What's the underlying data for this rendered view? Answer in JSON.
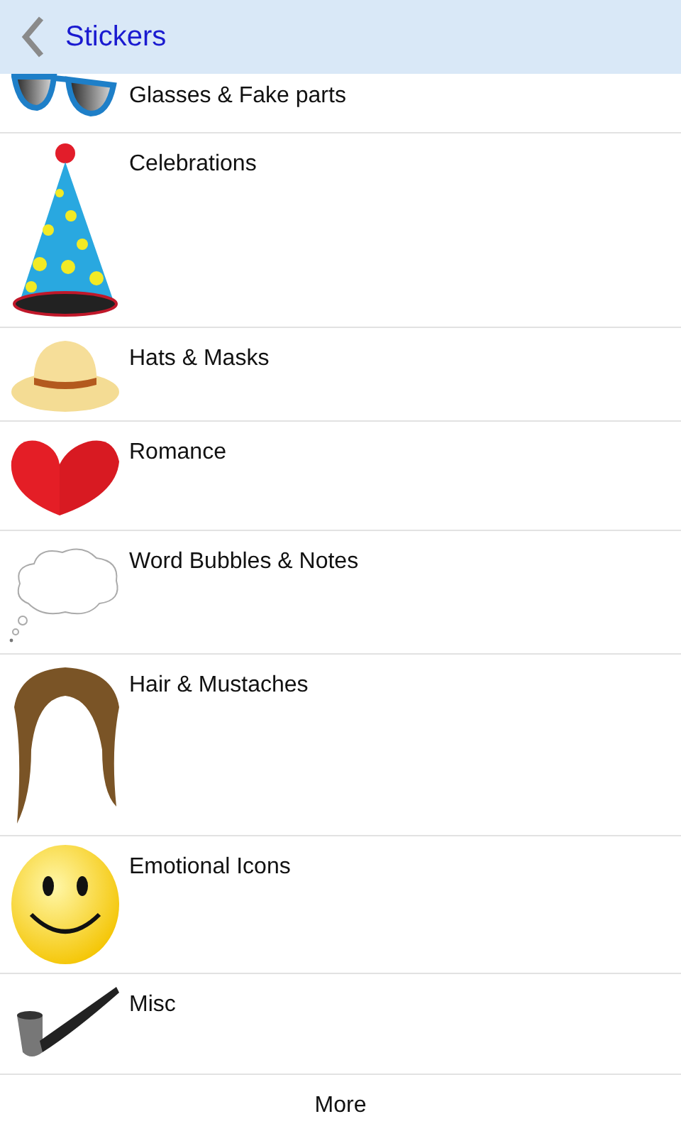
{
  "header": {
    "title": "Stickers"
  },
  "categories": [
    {
      "label": "Glasses & Fake parts",
      "kind": "glasses"
    },
    {
      "label": "Celebrations",
      "kind": "party-hat"
    },
    {
      "label": "Hats & Masks",
      "kind": "hat"
    },
    {
      "label": "Romance",
      "kind": "hearts"
    },
    {
      "label": "Word Bubbles & Notes",
      "kind": "bubble"
    },
    {
      "label": "Hair & Mustaches",
      "kind": "hair"
    },
    {
      "label": "Emotional Icons",
      "kind": "smiley"
    },
    {
      "label": "Misc",
      "kind": "pipe"
    }
  ],
  "footer": {
    "button": "More"
  }
}
